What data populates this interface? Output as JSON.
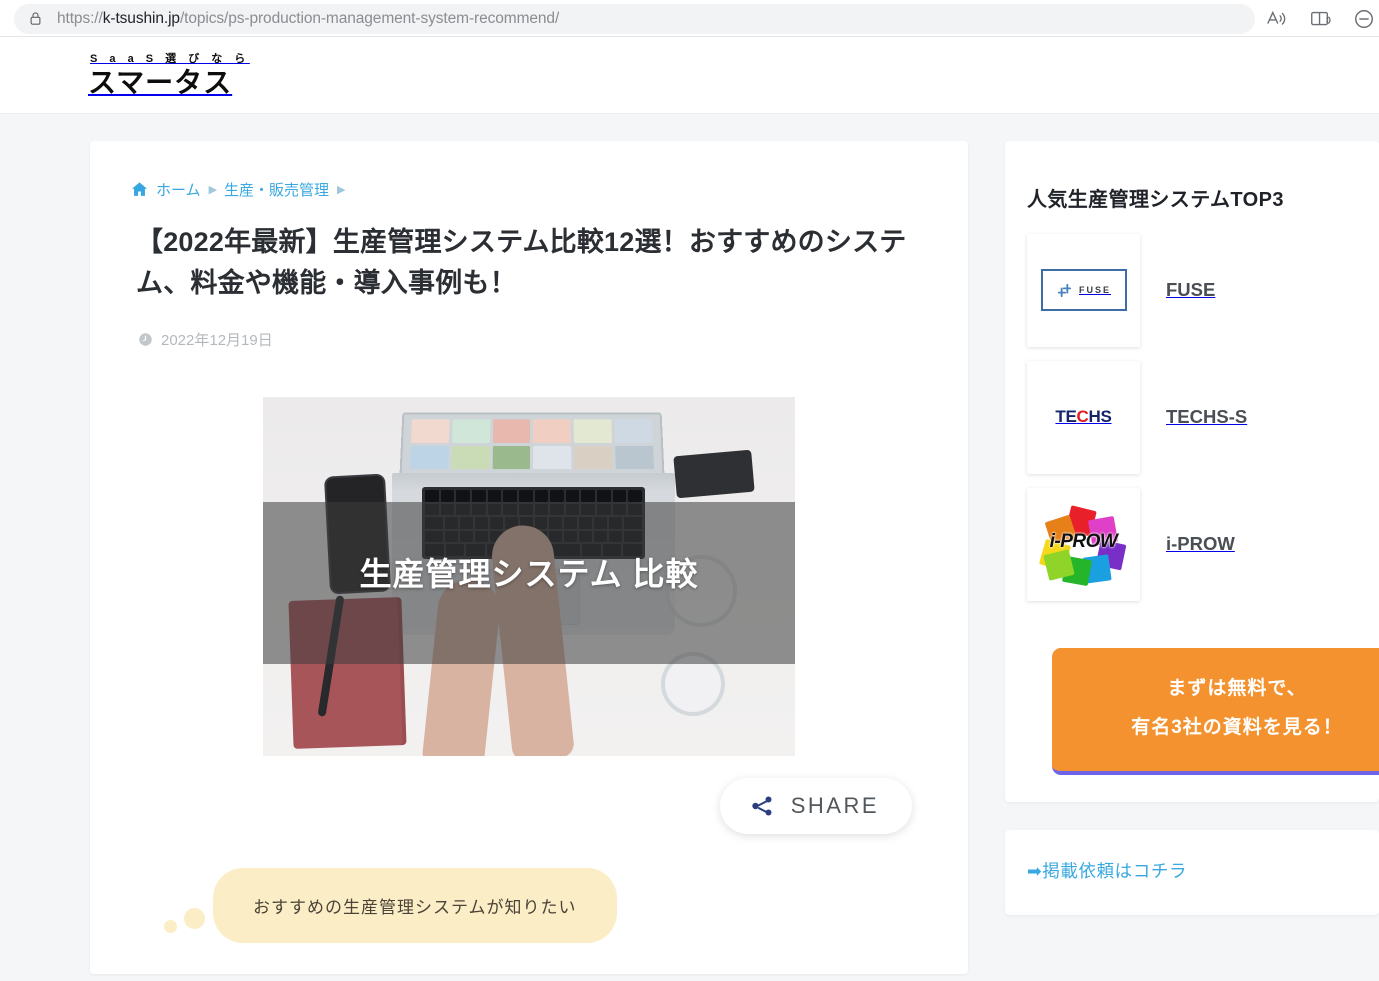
{
  "browser": {
    "url_prefix": "https://",
    "url_host": "k-tsushin.jp",
    "url_path": "/topics/ps-production-management-system-recommend/",
    "lock_icon": "lock-icon",
    "read_aloud_icon": "read-aloud-icon",
    "immersive_reader_icon": "immersive-reader-icon",
    "zoom_out_icon": "zoom-out-icon"
  },
  "site": {
    "logo_kicker": "S a a S 選 び な ら",
    "logo_main": "スマータス"
  },
  "breadcrumb": {
    "home_icon": "home-icon",
    "home_label": "ホーム",
    "separator": "▶",
    "category_label": "生産・販売管理",
    "trailing_separator": "▶"
  },
  "article": {
    "title": "【2022年最新】生産管理システム比較12選！おすすめのシステム、料金や機能・導入事例も！",
    "clock_icon": "clock-icon",
    "date": "2022年12月19日",
    "hero_overlay_text": "生産管理システム 比較",
    "share_icon": "share-icon",
    "share_label": "SHARE",
    "speech_bubble": "おすすめの生産管理システムが知りたい"
  },
  "sidebar": {
    "ranking_title": "人気生産管理システムTOP3",
    "items": [
      {
        "logo_text": "FUSE",
        "name": "FUSE"
      },
      {
        "logo_text": "TECHS",
        "name": "TECHS-S"
      },
      {
        "logo_text": "i-PROW",
        "name": "i-PROW"
      }
    ],
    "cta_line1": "まずは無料で、",
    "cta_line2": "有名3社の資料を見る！",
    "request_link": "➡掲載依頼はコチラ"
  },
  "colors": {
    "accent_blue": "#3aa8e0",
    "cta_orange": "#f3922e",
    "cta_underline": "#6f63e8",
    "bubble_yellow": "#fbeec6",
    "page_bg": "#f4f6f8"
  }
}
